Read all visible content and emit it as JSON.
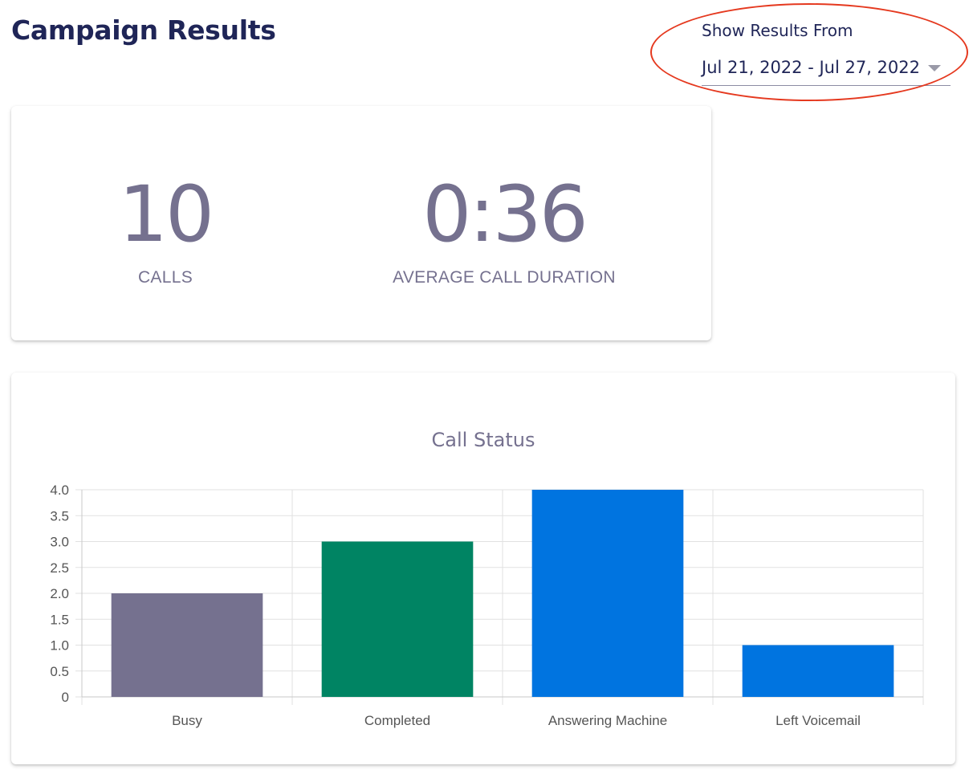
{
  "page": {
    "title": "Campaign Results"
  },
  "filter": {
    "label": "Show Results From",
    "selected": "Jul 21, 2022 - Jul 27, 2022"
  },
  "stats": {
    "calls": {
      "value": "10",
      "label": "CALLS"
    },
    "duration": {
      "value": "0:36",
      "label": "AVERAGE CALL DURATION"
    }
  },
  "colors": {
    "title": "#1f2557",
    "muted": "#75718f",
    "annotation": "#e5391f"
  },
  "chart_data": {
    "type": "bar",
    "title": "Call Status",
    "categories": [
      "Busy",
      "Completed",
      "Answering Machine",
      "Left Voicemail"
    ],
    "values": [
      2,
      3,
      4,
      1
    ],
    "colors": [
      "#75718f",
      "#008463",
      "#0074e0",
      "#0074e0"
    ],
    "yticks": [
      "0",
      "0.5",
      "1.0",
      "1.5",
      "2.0",
      "2.5",
      "3.0",
      "3.5",
      "4.0"
    ],
    "ylim": [
      0,
      4
    ],
    "xlabel": "",
    "ylabel": "",
    "grid": true
  }
}
